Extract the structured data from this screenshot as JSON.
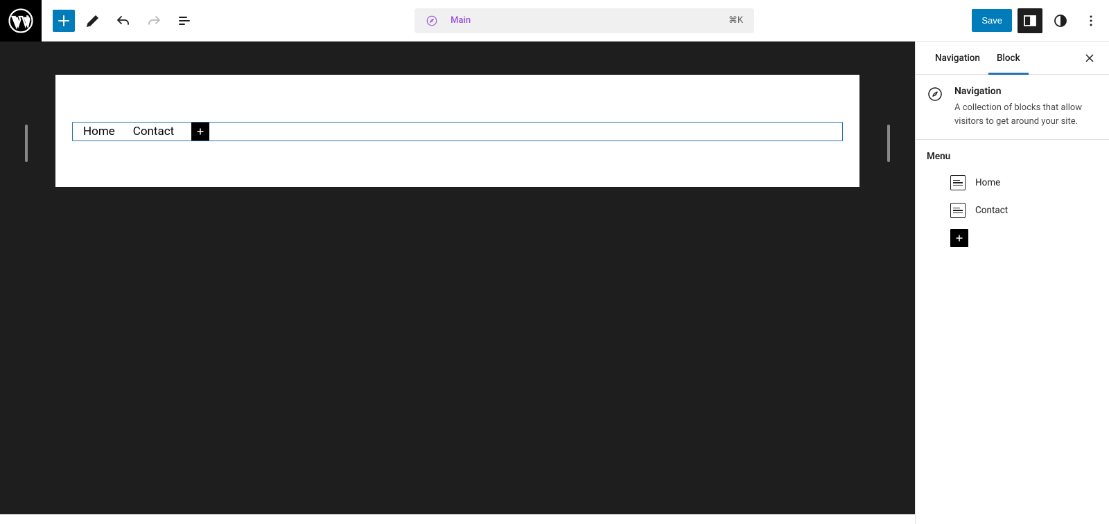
{
  "toolbar": {
    "document_label": "Main",
    "shortcut": "⌘K",
    "save_label": "Save"
  },
  "canvas": {
    "nav_links": [
      "Home",
      "Contact"
    ]
  },
  "sidebar": {
    "tabs": [
      "Navigation",
      "Block"
    ],
    "active_tab": "Block",
    "block": {
      "title": "Navigation",
      "description": "A collection of blocks that allow visitors to get around your site."
    },
    "menu": {
      "title": "Menu",
      "items": [
        "Home",
        "Contact"
      ]
    }
  }
}
